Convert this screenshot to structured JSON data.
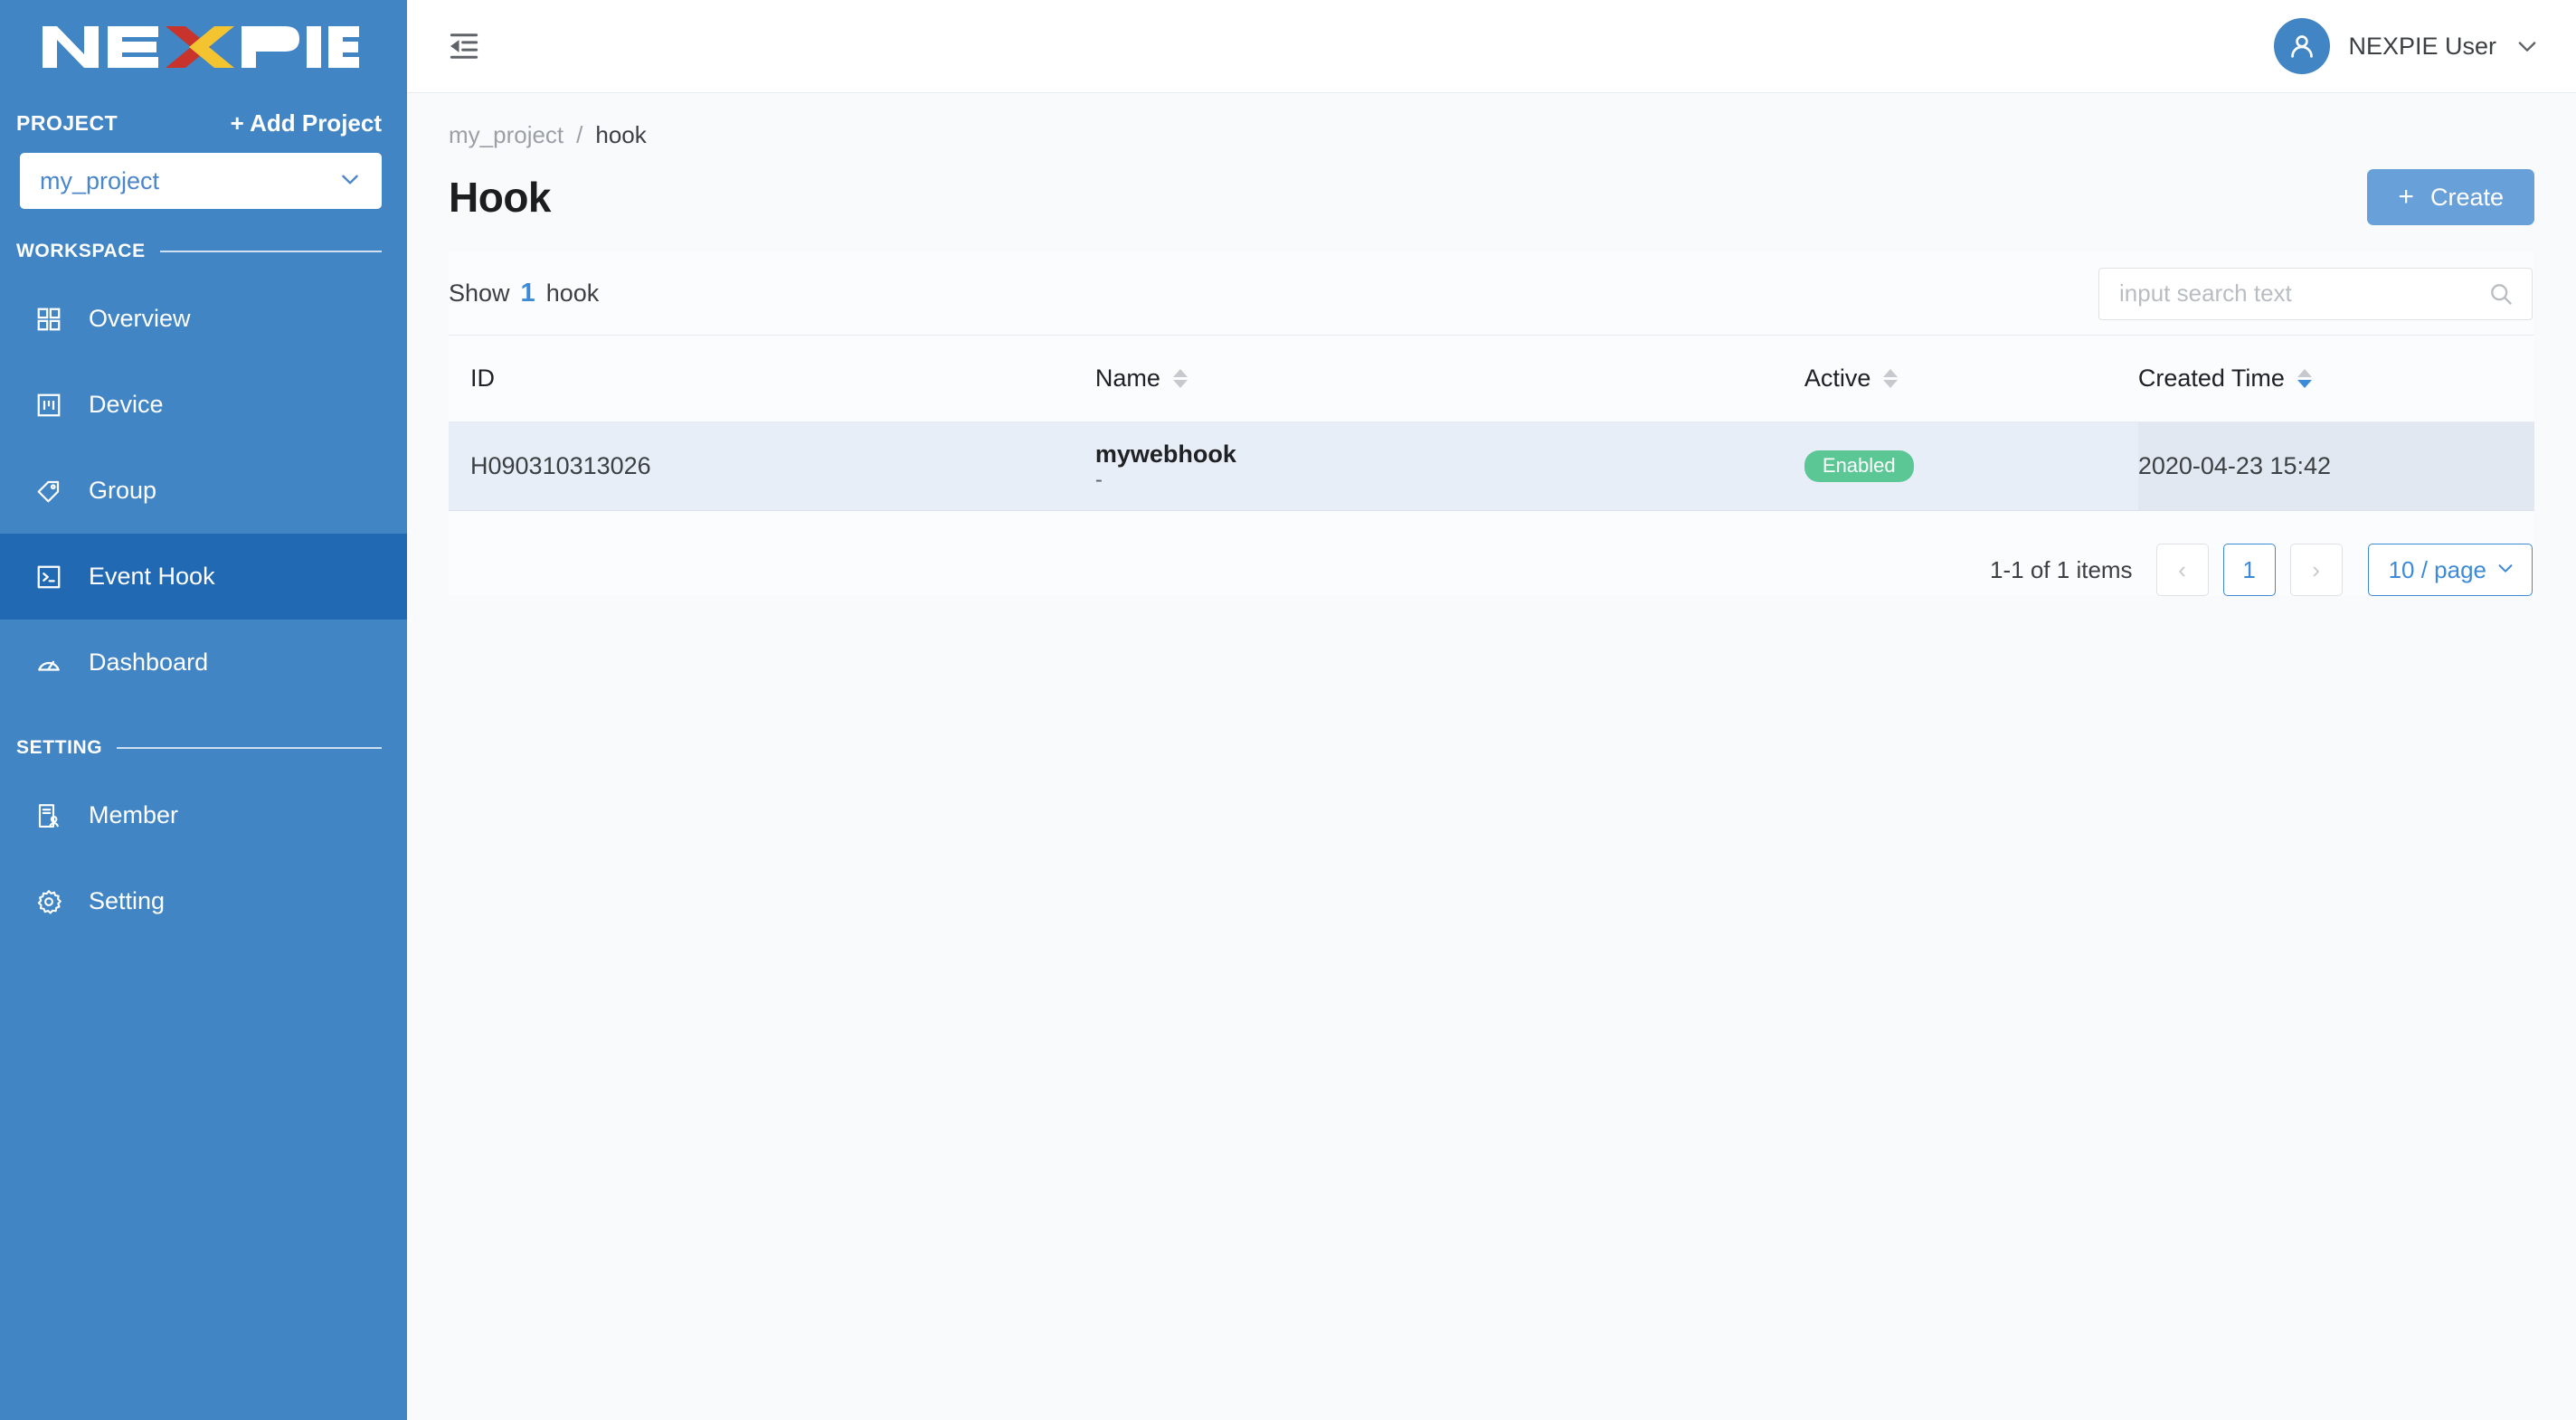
{
  "brand": {
    "logo_text": "NEXPIE",
    "logo_colors": {
      "letters": "#ffffff",
      "x_left": "#c8342b",
      "x_right": "#f4c430"
    },
    "sidebar_bg": "#4285c5",
    "active_bg": "#2269b4",
    "accent": "#3d8ad6"
  },
  "sidebar": {
    "project_label": "PROJECT",
    "add_project_label": "+ Add Project",
    "project_selected": "my_project",
    "sections": [
      {
        "title": "WORKSPACE"
      },
      {
        "title": "SETTING"
      }
    ],
    "workspace_items": [
      {
        "label": "Overview",
        "icon": "grid-icon",
        "active": false
      },
      {
        "label": "Device",
        "icon": "device-icon",
        "active": false
      },
      {
        "label": "Group",
        "icon": "tag-icon",
        "active": false
      },
      {
        "label": "Event Hook",
        "icon": "terminal-icon",
        "active": true
      },
      {
        "label": "Dashboard",
        "icon": "gauge-icon",
        "active": false
      }
    ],
    "setting_items": [
      {
        "label": "Member",
        "icon": "member-icon",
        "active": false
      },
      {
        "label": "Setting",
        "icon": "gear-icon",
        "active": false
      }
    ]
  },
  "topbar": {
    "fold_icon": "menu-fold-icon",
    "user_name": "NEXPIE User",
    "avatar_icon": "user-icon",
    "chevron_icon": "chevron-down-icon"
  },
  "breadcrumb": {
    "root": "my_project",
    "separator": "/",
    "current": "hook"
  },
  "page": {
    "title": "Hook",
    "create_label": "Create",
    "create_plus": "+"
  },
  "toolbar": {
    "show_prefix": "Show",
    "show_count": "1",
    "show_suffix": "hook",
    "search_placeholder": "input search text",
    "search_value": "",
    "search_icon": "search-icon"
  },
  "table": {
    "columns": [
      {
        "key": "id",
        "label": "ID",
        "sortable": false,
        "sort": "none"
      },
      {
        "key": "name",
        "label": "Name",
        "sortable": true,
        "sort": "none"
      },
      {
        "key": "active",
        "label": "Active",
        "sortable": true,
        "sort": "none"
      },
      {
        "key": "time",
        "label": "Created Time",
        "sortable": true,
        "sort": "desc"
      }
    ],
    "rows": [
      {
        "id": "H090310313026",
        "name": "mywebhook",
        "name_sub": "-",
        "active": "Enabled",
        "active_color": "#5ac795",
        "created_time": "2020-04-23 15:42"
      }
    ]
  },
  "pagination": {
    "total_text": "1-1 of 1 items",
    "prev_label": "‹",
    "next_label": "›",
    "current_page": "1",
    "page_size_label": "10 / page"
  }
}
